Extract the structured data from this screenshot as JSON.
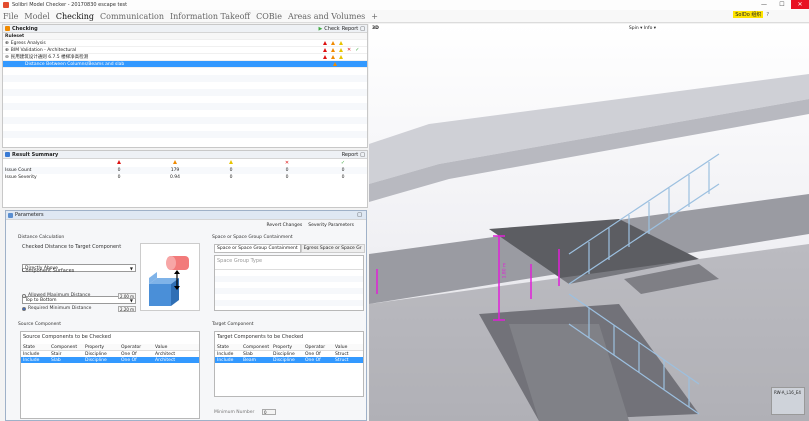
{
  "window": {
    "title": "Solibri Model Checker - 20170830 escape test",
    "controls": [
      "—",
      "☐",
      "✕"
    ]
  },
  "menu": {
    "items": [
      "File",
      "Model",
      "Checking",
      "Communication",
      "Information Takeoff",
      "COBie",
      "Areas and Volumes",
      "+"
    ],
    "active_index": 2,
    "user_badge": "SolDo 组织",
    "help": "?"
  },
  "checking_panel": {
    "title": "Checking",
    "check_label": "Check",
    "report_label": "Report",
    "column_header": "Ruleset",
    "rows": [
      {
        "text": "Egress Analysis",
        "status": [
          "red",
          "orange",
          "yellow"
        ]
      },
      {
        "text": "BIM Validation - Architectural",
        "status": [
          "red",
          "orange",
          "yellow",
          "x",
          "check"
        ]
      },
      {
        "text": "民用建筑设计通则 6.7.5 楼梯净高检测",
        "status": [
          "red",
          "orange",
          "yellow"
        ]
      },
      {
        "text": "Distance Between Columns/Beams and slab",
        "selected": true
      }
    ]
  },
  "result_summary": {
    "title": "Result Summary",
    "report_label": "Report",
    "rows": [
      {
        "label": "Issue Count",
        "values": [
          "0",
          "179",
          "0",
          "0",
          "0"
        ]
      },
      {
        "label": "Issue Severity",
        "values": [
          "0",
          "0.94",
          "0",
          "0",
          "0"
        ]
      }
    ]
  },
  "parameters": {
    "title": "Parameters",
    "revert_label": "Revert Changes",
    "severity_label": "Severity Parameters",
    "distance_section": "Distance Calculation",
    "checked_distance_label": "Checked Distance to Target Component",
    "checked_distance_value": "Directly Above",
    "component_surfaces_label": "Component Surfaces",
    "component_surfaces_value": "Top to Bottom",
    "allowed_max_label": "Allowed Maximum Distance",
    "allowed_max_value": "2.00 m",
    "required_min_label": "Required Minimum Distance",
    "required_min_value": "2.20 m",
    "space_section": "Space or Space Group Containment",
    "space_tab1": "Space or Space Group Containment",
    "space_tab2": "Egress Space or Space Gr",
    "space_group_type_label": "Space Group Type",
    "source_section": "Source Component",
    "source_title": "Source Components to be Checked",
    "target_section": "Target Component",
    "target_title": "Target Components to be Checked",
    "table_headers": [
      "State",
      "Component",
      "Property",
      "Operator",
      "Value"
    ],
    "source_rows": [
      [
        "Include",
        "Stair",
        "Discipline",
        "One Of",
        "Architect"
      ],
      [
        "Include",
        "Slab",
        "Discipline",
        "One Of",
        "Architect"
      ]
    ],
    "target_rows": [
      [
        "Include",
        "Slab",
        "Discipline",
        "One Of",
        "Struct"
      ],
      [
        "Include",
        "Beam",
        "Discipline",
        "One Of",
        "Struct"
      ]
    ],
    "minimum_number_label": "Minimum Number",
    "minimum_number_value": "0"
  },
  "view3d": {
    "title": "3D",
    "toolbar": "Spin ▾  Info ▾",
    "dimension_label": "1.80 m",
    "badge": "RW-A_L16_E4",
    "colors": {
      "stair_frame": "#9cc0e0",
      "magenta": "#e020d8"
    }
  }
}
